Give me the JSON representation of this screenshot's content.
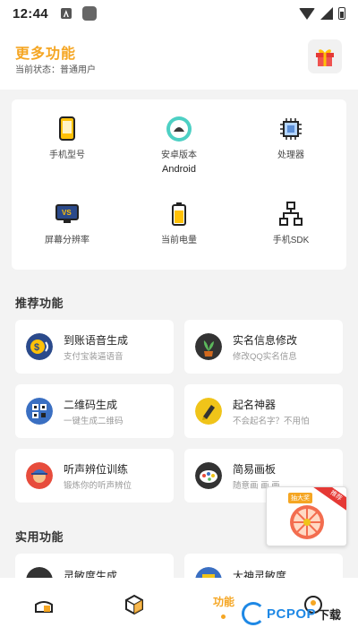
{
  "status_bar": {
    "time": "12:44"
  },
  "header": {
    "title": "更多功能",
    "status": "当前状态：普通用户"
  },
  "device_info": [
    {
      "label": "手机型号",
      "value": "",
      "icon": "phone-icon"
    },
    {
      "label": "安卓版本",
      "value": "Android",
      "icon": "android-icon"
    },
    {
      "label": "处理器",
      "value": "",
      "icon": "cpu-icon"
    },
    {
      "label": "屏幕分辨率",
      "value": "",
      "icon": "screen-icon"
    },
    {
      "label": "当前电量",
      "value": "",
      "icon": "battery-icon"
    },
    {
      "label": "手机SDK",
      "value": "",
      "icon": "sdk-icon"
    }
  ],
  "sections": {
    "recommended": "推荐功能",
    "practical": "实用功能"
  },
  "features": [
    {
      "title": "到账语音生成",
      "subtitle": "支付宝装逼语音",
      "icon": "coin-voice-icon"
    },
    {
      "title": "实名信息修改",
      "subtitle": "修改QQ实名信息",
      "icon": "plant-icon"
    },
    {
      "title": "二维码生成",
      "subtitle": "一键生成二维码",
      "icon": "qrcode-icon"
    },
    {
      "title": "起名神器",
      "subtitle": "不会起名字？不用怕",
      "icon": "pen-icon"
    },
    {
      "title": "听声辨位训练",
      "subtitle": "锻炼你的听声辨位",
      "icon": "soldier-icon"
    },
    {
      "title": "简易画板",
      "subtitle": "随意画 画 画...",
      "icon": "palette-icon"
    },
    {
      "title": "灵敏度生成",
      "subtitle": "",
      "icon": "sensitivity-icon"
    },
    {
      "title": "大神灵敏度",
      "subtitle": "",
      "icon": "pro-sensitivity-icon"
    }
  ],
  "promo": {
    "badge": "推荐",
    "label": "抽大奖"
  },
  "bottom_nav": {
    "active_label": "功能"
  },
  "watermark": {
    "brand": "PCPOP",
    "suffix": "下载"
  },
  "colors": {
    "accent": "#f5a623",
    "background": "#f3f3f3"
  }
}
